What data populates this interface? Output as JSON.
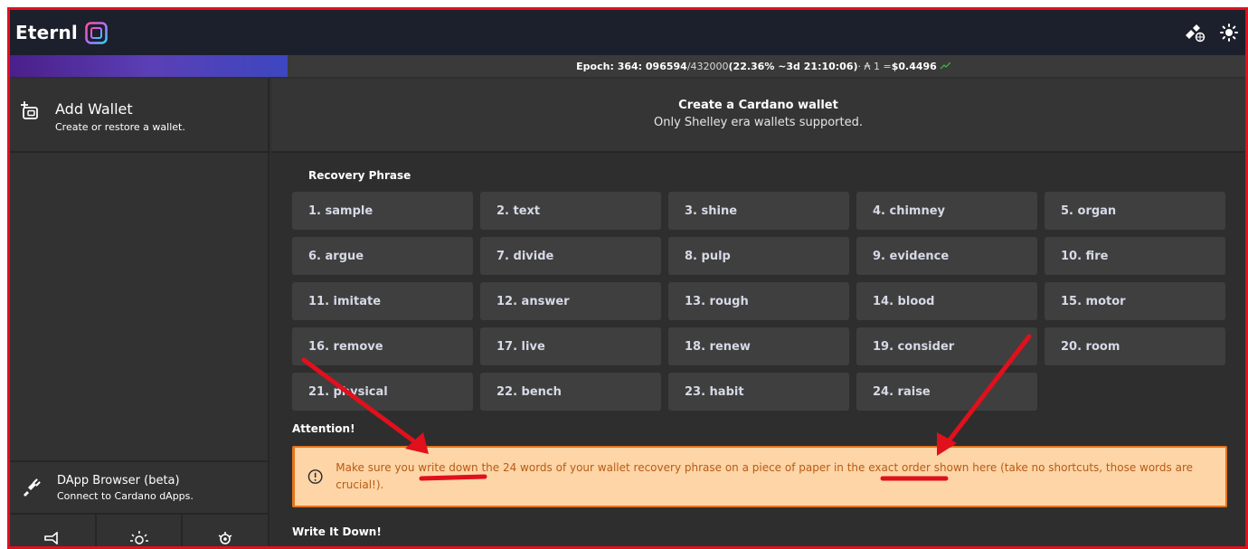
{
  "app": {
    "name": "Eternl"
  },
  "epoch": {
    "label": "Epoch: 364: 096594",
    "total": " /432000 ",
    "detail": "(22.36% ~3d 21:10:06)",
    "price_prefix": " · ₳ 1 = ",
    "price": "$0.4496",
    "progress": 0.2236
  },
  "sidebar": {
    "add_wallet": {
      "title": "Add Wallet",
      "subtitle": "Create or restore a wallet."
    },
    "dapp": {
      "title": "DApp Browser (beta)",
      "subtitle": "Connect to Cardano dApps."
    },
    "bottom_icons": [
      "megaphone-icon",
      "sun-icon",
      "settings-icon"
    ]
  },
  "main": {
    "title": "Create a Cardano wallet",
    "subtitle": "Only Shelley era wallets supported.",
    "recovery_label": "Recovery Phrase",
    "words": [
      "1. sample",
      "2. text",
      "3. shine",
      "4. chimney",
      "5. organ",
      "6. argue",
      "7. divide",
      "8. pulp",
      "9. evidence",
      "10. fire",
      "11. imitate",
      "12. answer",
      "13. rough",
      "14. blood",
      "15. motor",
      "16. remove",
      "17. live",
      "18. renew",
      "19. consider",
      "20. room",
      "21. physical",
      "22. bench",
      "23. habit",
      "24. raise"
    ],
    "attention_label": "Attention!",
    "warning": "Make sure you write down the 24 words of your wallet recovery phrase on a piece of paper in the exact order shown here (take no shortcuts, those words are crucial!).",
    "write_label": "Write It Down!"
  },
  "colors": {
    "annotation": "#e0101c",
    "warning_bg": "#fdd5a6",
    "warning_text": "#b85a17",
    "trend_up": "#3bb34a"
  }
}
